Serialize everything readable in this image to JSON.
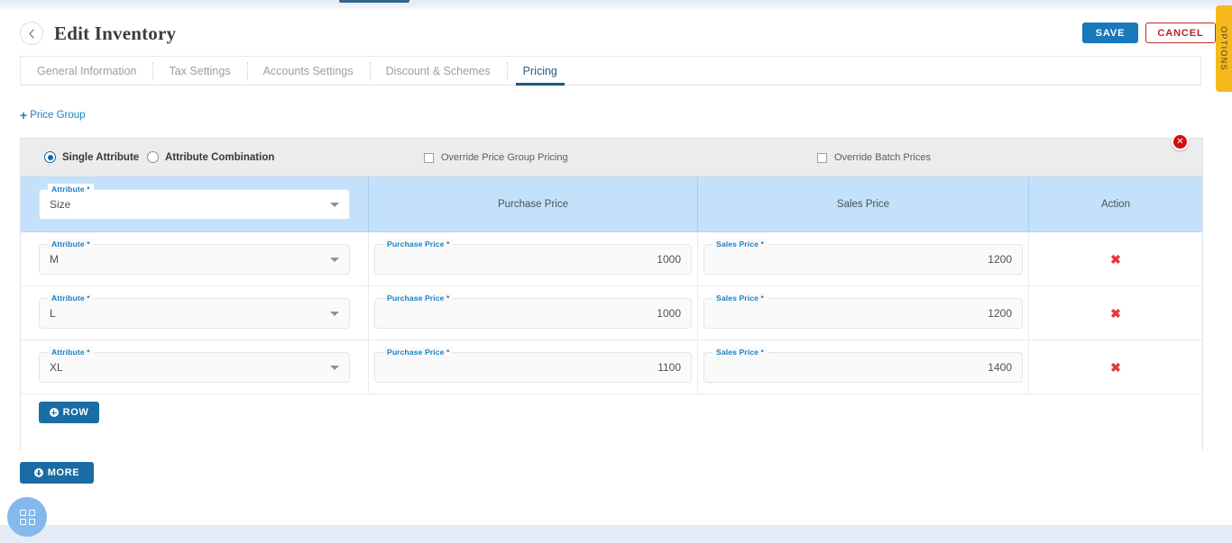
{
  "header": {
    "title": "Edit Inventory",
    "back_icon": "chevron-left-icon",
    "save_label": "SAVE",
    "cancel_label": "CANCEL"
  },
  "options_tab": {
    "label": "OPTIONS",
    "color": "#f5b91c"
  },
  "tabs": [
    {
      "label": "General Information",
      "active": false
    },
    {
      "label": "Tax Settings",
      "active": false
    },
    {
      "label": "Accounts Settings",
      "active": false
    },
    {
      "label": "Discount & Schemes",
      "active": false
    },
    {
      "label": "Pricing",
      "active": true
    }
  ],
  "price_group_link": {
    "label": "Price Group",
    "plus": "+"
  },
  "panel": {
    "close_icon": "close-icon",
    "close_glyph": "✕",
    "mode_options": [
      {
        "label": "Single Attribute",
        "selected": true
      },
      {
        "label": "Attribute Combination",
        "selected": false
      }
    ],
    "checkboxes": [
      {
        "label": "Override Price Group Pricing",
        "checked": false
      },
      {
        "label": "Override Batch Prices",
        "checked": false
      }
    ]
  },
  "grid": {
    "header": {
      "attribute_legend": "Attribute",
      "attribute_required": "*",
      "attribute_value": "Size",
      "purchase_price": "Purchase Price",
      "sales_price": "Sales Price",
      "action": "Action"
    },
    "labels": {
      "attribute": "Attribute",
      "purchase_price": "Purchase Price",
      "sales_price": "Sales Price",
      "required": "*"
    },
    "rows": [
      {
        "attribute": "M",
        "purchase_price": "1000",
        "sales_price": "1200",
        "delete_glyph": "✖"
      },
      {
        "attribute": "L",
        "purchase_price": "1000",
        "sales_price": "1200",
        "delete_glyph": "✖"
      },
      {
        "attribute": "XL",
        "purchase_price": "1100",
        "sales_price": "1400",
        "delete_glyph": "✖"
      }
    ],
    "add_row_label": "ROW"
  },
  "more_button": {
    "label": "MORE"
  },
  "fab": {
    "icon": "grid-apps-icon"
  },
  "colors": {
    "primary_blue": "#1878b9",
    "dark_blue": "#1a6ca5",
    "danger_red": "#c0272d",
    "header_blue_bg": "#c3e1fa",
    "label_blue": "#1a7fc1",
    "amber": "#f5b91c"
  }
}
